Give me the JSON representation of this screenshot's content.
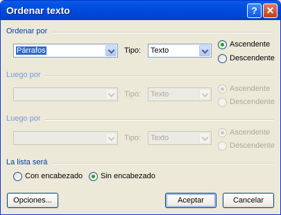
{
  "window": {
    "title": "Ordenar texto",
    "help_icon": "?",
    "close_icon": "✕"
  },
  "sort_by": {
    "label": "Ordenar por",
    "field_value": "Párrafos",
    "type_label": "Tipo:",
    "type_value": "Texto",
    "ascending_label": "Ascendente",
    "descending_label": "Descendente",
    "selected": "ascending"
  },
  "then_by_1": {
    "label": "Luego por",
    "field_value": "",
    "type_label": "Tipo:",
    "type_value": "Texto",
    "ascending_label": "Ascendente",
    "descending_label": "Descendente"
  },
  "then_by_2": {
    "label": "Luego por",
    "field_value": "",
    "type_label": "Tipo:",
    "type_value": "Texto",
    "ascending_label": "Ascendente",
    "descending_label": "Descendente"
  },
  "header_list": {
    "label": "La lista será",
    "with_header_label": "Con encabezado",
    "without_header_label": "Sin encabezado",
    "selected": "without_header"
  },
  "buttons": {
    "options": "Opciones...",
    "ok": "Aceptar",
    "cancel": "Cancelar"
  }
}
